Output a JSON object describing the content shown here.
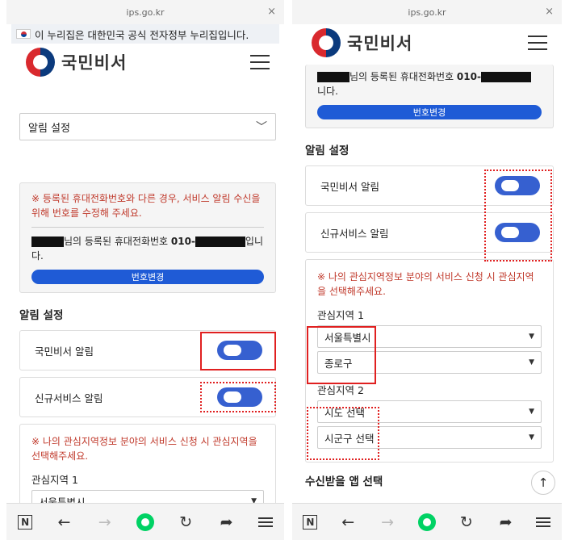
{
  "left": {
    "url": "ips.go.kr",
    "gov_banner": "이 누리집은 대한민국 공식 전자정부 누리집입니다.",
    "brand": "국민비서",
    "category_select": "알림 설정",
    "notice_warning": "※ 등록된 휴대전화번호와 다른 경우, 서비스 알림 수신을 위해 번호를 수정해 주세요.",
    "phone_prefix": "님의 등록된 휴대전화번호 ",
    "phone_number": "010-",
    "phone_suffix": "입니다.",
    "change_button": "번호변경",
    "section_title": "알림 설정",
    "toggles": [
      "국민비서 알림",
      "신규서비스 알림"
    ],
    "region_warning": "※ 나의 관심지역정보 분야의 서비스 신청 시 관심지역을 선택해주세요.",
    "region1_label": "관심지역 1",
    "region1_value": "서울특별시"
  },
  "right": {
    "url": "ips.go.kr",
    "brand": "국민비서",
    "phone_prefix": "님의 등록된 휴대전화번호 ",
    "phone_number": "010-",
    "phone_suffix": "니다.",
    "change_button": "번호변경",
    "section_title": "알림 설정",
    "toggles": [
      "국민비서 알림",
      "신규서비스 알림"
    ],
    "region_warning": "※ 나의 관심지역정보 분야의 서비스 신청 시 관심지역을 선택해주세요.",
    "region1_label": "관심지역 1",
    "region1_sido": "서울특별시",
    "region1_sigungu": "종로구",
    "region2_label": "관심지역 2",
    "region2_sido": "시도 선택",
    "region2_sigungu": "시군구 선택",
    "app_select_title": "수신받을 앱 선택"
  },
  "colors": {
    "accent": "#1f5bd6",
    "warning": "#c0392b",
    "highlight": "#e02020",
    "toggle": "#3660d0"
  },
  "icons": [
    "naver-n-icon",
    "back-arrow-icon",
    "forward-arrow-icon",
    "home-icon",
    "refresh-icon",
    "share-icon",
    "menu-icon",
    "scroll-top-icon"
  ]
}
